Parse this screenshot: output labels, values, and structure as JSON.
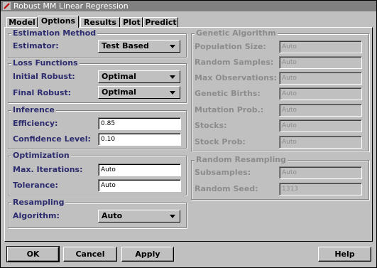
{
  "window": {
    "title": "Robust MM Linear Regression"
  },
  "tabs": [
    {
      "label": "Model"
    },
    {
      "label": "Options"
    },
    {
      "label": "Results"
    },
    {
      "label": "Plot"
    },
    {
      "label": "Predict"
    }
  ],
  "estimation_method": {
    "title": "Estimation Method",
    "estimator_label": "Estimator:",
    "estimator_value": "Test Based"
  },
  "loss_functions": {
    "title": "Loss Functions",
    "initial_label": "Initial Robust:",
    "initial_value": "Optimal",
    "final_label": "Final Robust:",
    "final_value": "Optimal"
  },
  "inference": {
    "title": "Inference",
    "efficiency_label": "Efficiency:",
    "efficiency_value": "0.85",
    "confidence_label": "Confidence Level:",
    "confidence_value": "0.10"
  },
  "optimization": {
    "title": "Optimization",
    "max_iter_label": "Max. Iterations:",
    "max_iter_value": "Auto",
    "tolerance_label": "Tolerance:",
    "tolerance_value": "Auto"
  },
  "resampling": {
    "title": "Resampling",
    "algorithm_label": "Algorithm:",
    "algorithm_value": "Auto"
  },
  "genetic": {
    "title": "Genetic Algorithm",
    "population_label": "Population Size:",
    "population_value": "Auto",
    "random_samples_label": "Random Samples:",
    "random_samples_value": "Auto",
    "max_obs_label": "Max Observations:",
    "max_obs_value": "Auto",
    "births_label": "Genetic Births:",
    "births_value": "Auto",
    "mutation_label": "Mutation Prob.:",
    "mutation_value": "Auto",
    "stocks_label": "Stocks:",
    "stocks_value": "Auto",
    "stock_prob_label": "Stock Prob:",
    "stock_prob_value": "Auto"
  },
  "random_resampling": {
    "title": "Random Resampling",
    "subsamples_label": "Subsamples:",
    "subsamples_value": "Auto",
    "seed_label": "Random Seed:",
    "seed_value": "1313"
  },
  "buttons": {
    "ok": "OK",
    "cancel": "Cancel",
    "apply": "Apply",
    "help": "Help"
  }
}
